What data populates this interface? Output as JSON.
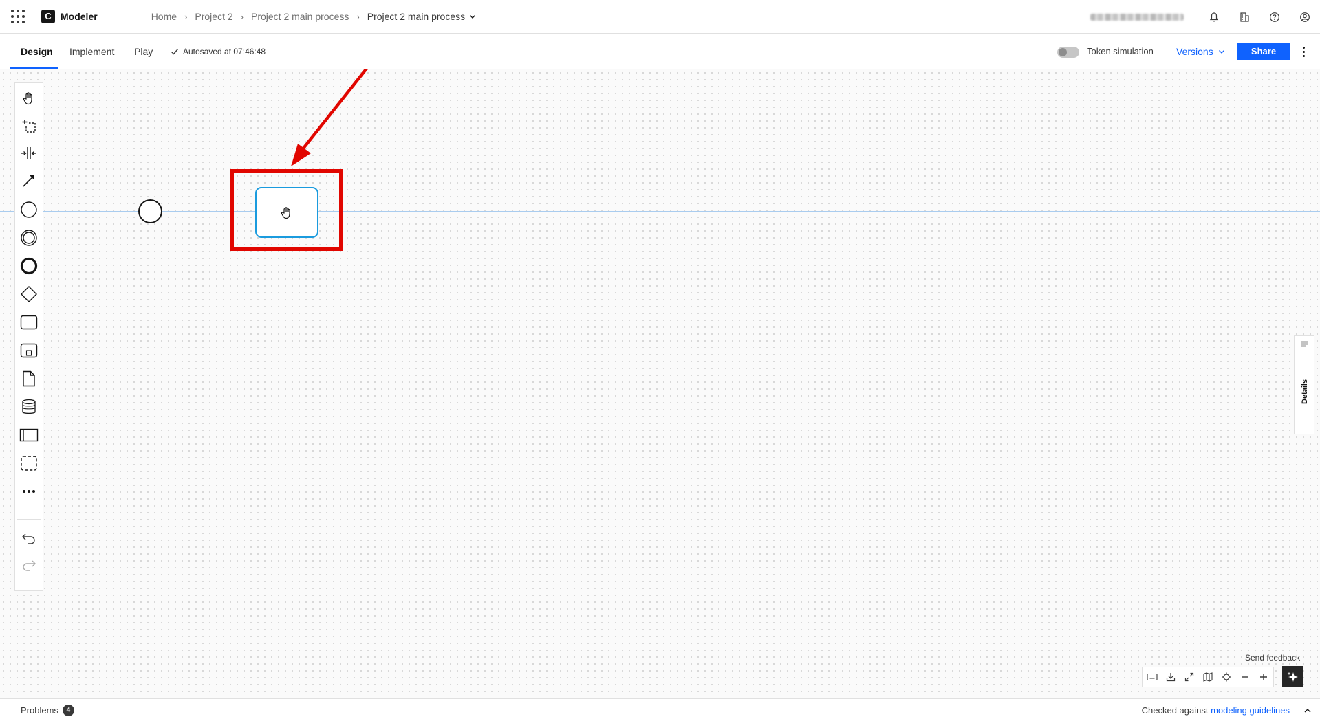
{
  "header": {
    "app_name": "Modeler",
    "logo_letter": "C",
    "breadcrumb": {
      "home": "Home",
      "project": "Project 2",
      "process": "Project 2 main process",
      "current": "Project 2 main process"
    },
    "icons": [
      "app-switcher-icon",
      "notification-icon",
      "organization-icon",
      "help-icon",
      "user-icon"
    ]
  },
  "subheader": {
    "tabs": {
      "design": "Design",
      "implement": "Implement",
      "play": "Play"
    },
    "autosave": "Autosaved at 07:46:48",
    "token_simulation": "Token simulation",
    "versions": "Versions",
    "share": "Share"
  },
  "details_tab": {
    "label": "Details"
  },
  "canvas_controls": {
    "send_feedback": "Send feedback"
  },
  "footer": {
    "problems_label": "Problems",
    "problems_count": "4",
    "checked_prefix": "Checked against",
    "guidelines_link": "modeling guidelines"
  },
  "colors": {
    "accent": "#0f62fe",
    "highlight": "#e10600",
    "task_border": "#1a9bde",
    "lane_line": "#a9ccef"
  }
}
